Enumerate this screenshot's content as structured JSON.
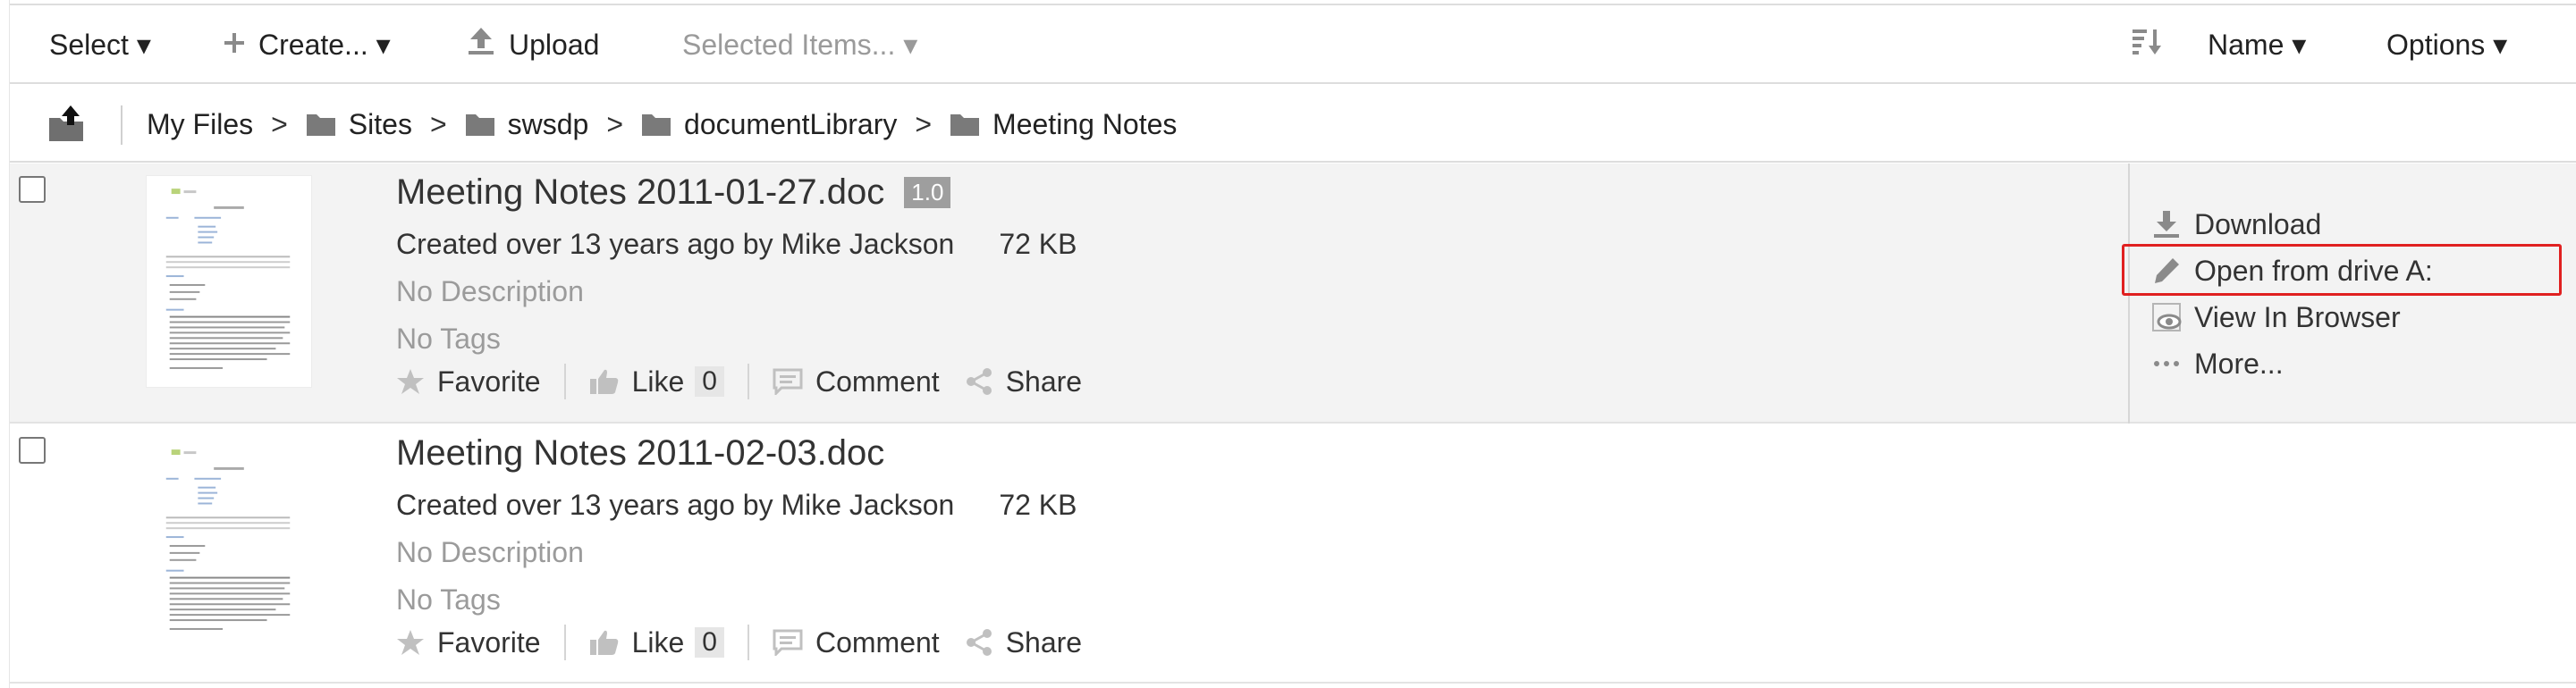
{
  "toolbar": {
    "select_label": "Select ▾",
    "create_label": "Create... ▾",
    "upload_label": "Upload",
    "selected_items_label": "Selected Items... ▾",
    "sort_label": "Name ▾",
    "options_label": "Options ▾"
  },
  "breadcrumb": {
    "items": [
      "My Files",
      "Sites",
      "swsdp",
      "documentLibrary",
      "Meeting Notes"
    ],
    "separator": ">"
  },
  "rows": [
    {
      "title": "Meeting Notes 2011-01-27.doc",
      "version": "1.0",
      "created": "Created over 13 years ago by Mike Jackson",
      "size": "72 KB",
      "description": "No Description",
      "tags": "No Tags",
      "favorite_label": "Favorite",
      "like_label": "Like",
      "like_count": "0",
      "comment_label": "Comment",
      "share_label": "Share"
    },
    {
      "title": "Meeting Notes 2011-02-03.doc",
      "created": "Created over 13 years ago by Mike Jackson",
      "size": "72 KB",
      "description": "No Description",
      "tags": "No Tags",
      "favorite_label": "Favorite",
      "like_label": "Like",
      "like_count": "0",
      "comment_label": "Comment",
      "share_label": "Share"
    }
  ],
  "side_menu": {
    "download": "Download",
    "open_from_drive": "Open from drive A:",
    "view_in_browser": "View In Browser",
    "more": "More..."
  },
  "icons": {
    "select": "none",
    "create": "plus-icon",
    "upload": "upload-icon",
    "sort": "sort-icon",
    "folder": "folder-icon",
    "favorite": "star-icon",
    "like": "thumbs-up-icon",
    "comment": "comment-icon",
    "share": "share-icon",
    "download": "download-icon",
    "edit": "pencil-icon",
    "view": "eye-icon",
    "more": "ellipsis-icon"
  },
  "colors": {
    "highlight": "#e02020",
    "selected_row": "#f3f3f3",
    "muted_text": "#9b9b9b"
  }
}
